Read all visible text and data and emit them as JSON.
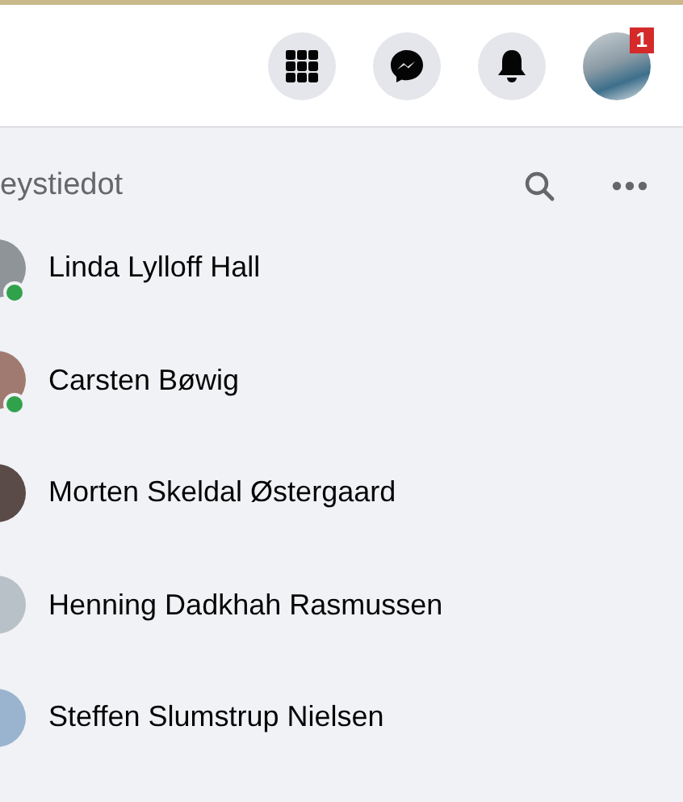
{
  "top_bar": {
    "account_badge": "1"
  },
  "contacts_panel": {
    "heading": "eystiedot",
    "contacts": [
      {
        "name": "Linda Lylloff Hall",
        "online": true
      },
      {
        "name": "Carsten Bøwig",
        "online": true
      },
      {
        "name": "Morten Skeldal Østergaard",
        "online": false
      },
      {
        "name": "Henning Dadkhah Rasmussen",
        "online": false
      },
      {
        "name": "Steffen Slumstrup Nielsen",
        "online": false
      }
    ]
  }
}
